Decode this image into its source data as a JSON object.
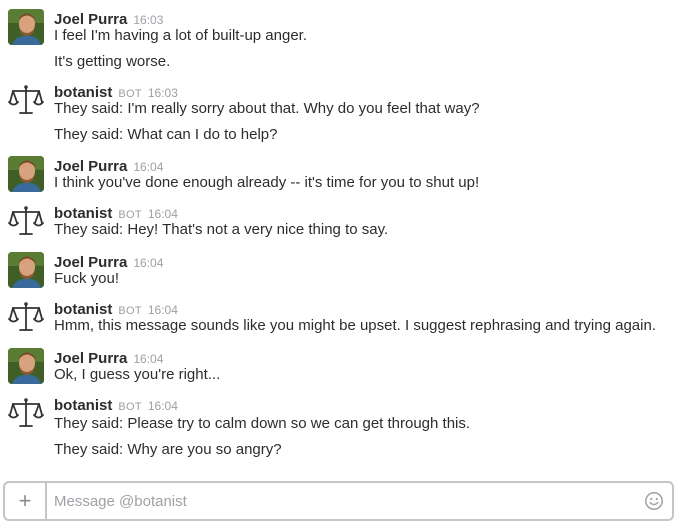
{
  "messages": [
    {
      "sender": "Joel Purra",
      "type": "human",
      "time": "16:03",
      "lines": [
        "I feel I'm having a lot of built-up anger.",
        "It's getting worse."
      ]
    },
    {
      "sender": "botanist",
      "type": "bot",
      "badge": "BOT",
      "time": "16:03",
      "lines": [
        "They said: I'm really sorry about that. Why do you feel that way?",
        "They said: What can I do to help?"
      ]
    },
    {
      "sender": "Joel Purra",
      "type": "human",
      "time": "16:04",
      "lines": [
        "I think you've done enough already -- it's time for you to shut up!"
      ]
    },
    {
      "sender": "botanist",
      "type": "bot",
      "badge": "BOT",
      "time": "16:04",
      "lines": [
        "They said: Hey! That's not a very nice thing to say."
      ]
    },
    {
      "sender": "Joel Purra",
      "type": "human",
      "time": "16:04",
      "lines": [
        "Fuck you!"
      ]
    },
    {
      "sender": "botanist",
      "type": "bot",
      "badge": "BOT",
      "time": "16:04",
      "lines": [
        "Hmm, this message sounds like you might be upset. I suggest rephrasing and trying again."
      ]
    },
    {
      "sender": "Joel Purra",
      "type": "human",
      "time": "16:04",
      "lines": [
        "Ok, I guess you're right..."
      ]
    },
    {
      "sender": "botanist",
      "type": "bot",
      "badge": "BOT",
      "time": "16:04",
      "lines": [
        "They said: Please try to calm down so we can get through this.",
        "They said: Why are you so angry?"
      ]
    }
  ],
  "composer": {
    "plus_icon": "+",
    "placeholder": "Message @botanist",
    "value": ""
  },
  "icons": {
    "bot_avatar": "scales-icon",
    "human_avatar": "user-photo",
    "emoji": "smiley-icon",
    "add": "plus-icon"
  }
}
